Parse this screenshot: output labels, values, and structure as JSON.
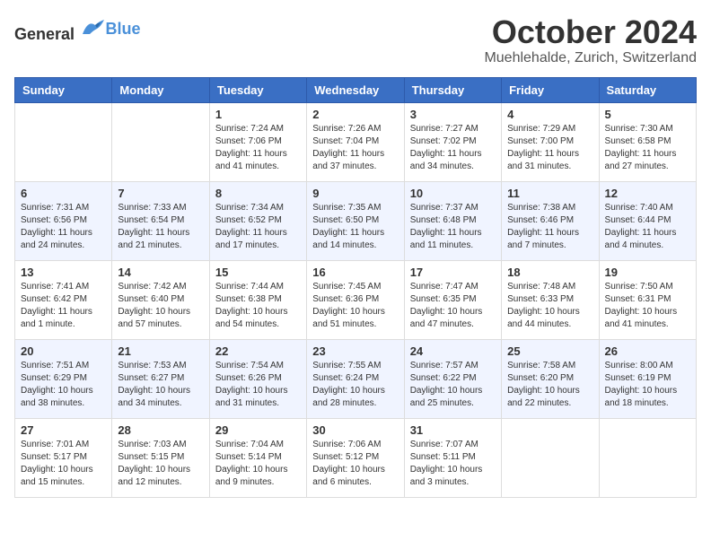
{
  "header": {
    "logo_general": "General",
    "logo_blue": "Blue",
    "month": "October 2024",
    "location": "Muehlehalde, Zurich, Switzerland"
  },
  "weekdays": [
    "Sunday",
    "Monday",
    "Tuesday",
    "Wednesday",
    "Thursday",
    "Friday",
    "Saturday"
  ],
  "weeks": [
    [
      {
        "day": "",
        "content": ""
      },
      {
        "day": "",
        "content": ""
      },
      {
        "day": "1",
        "content": "Sunrise: 7:24 AM\nSunset: 7:06 PM\nDaylight: 11 hours and 41 minutes."
      },
      {
        "day": "2",
        "content": "Sunrise: 7:26 AM\nSunset: 7:04 PM\nDaylight: 11 hours and 37 minutes."
      },
      {
        "day": "3",
        "content": "Sunrise: 7:27 AM\nSunset: 7:02 PM\nDaylight: 11 hours and 34 minutes."
      },
      {
        "day": "4",
        "content": "Sunrise: 7:29 AM\nSunset: 7:00 PM\nDaylight: 11 hours and 31 minutes."
      },
      {
        "day": "5",
        "content": "Sunrise: 7:30 AM\nSunset: 6:58 PM\nDaylight: 11 hours and 27 minutes."
      }
    ],
    [
      {
        "day": "6",
        "content": "Sunrise: 7:31 AM\nSunset: 6:56 PM\nDaylight: 11 hours and 24 minutes."
      },
      {
        "day": "7",
        "content": "Sunrise: 7:33 AM\nSunset: 6:54 PM\nDaylight: 11 hours and 21 minutes."
      },
      {
        "day": "8",
        "content": "Sunrise: 7:34 AM\nSunset: 6:52 PM\nDaylight: 11 hours and 17 minutes."
      },
      {
        "day": "9",
        "content": "Sunrise: 7:35 AM\nSunset: 6:50 PM\nDaylight: 11 hours and 14 minutes."
      },
      {
        "day": "10",
        "content": "Sunrise: 7:37 AM\nSunset: 6:48 PM\nDaylight: 11 hours and 11 minutes."
      },
      {
        "day": "11",
        "content": "Sunrise: 7:38 AM\nSunset: 6:46 PM\nDaylight: 11 hours and 7 minutes."
      },
      {
        "day": "12",
        "content": "Sunrise: 7:40 AM\nSunset: 6:44 PM\nDaylight: 11 hours and 4 minutes."
      }
    ],
    [
      {
        "day": "13",
        "content": "Sunrise: 7:41 AM\nSunset: 6:42 PM\nDaylight: 11 hours and 1 minute."
      },
      {
        "day": "14",
        "content": "Sunrise: 7:42 AM\nSunset: 6:40 PM\nDaylight: 10 hours and 57 minutes."
      },
      {
        "day": "15",
        "content": "Sunrise: 7:44 AM\nSunset: 6:38 PM\nDaylight: 10 hours and 54 minutes."
      },
      {
        "day": "16",
        "content": "Sunrise: 7:45 AM\nSunset: 6:36 PM\nDaylight: 10 hours and 51 minutes."
      },
      {
        "day": "17",
        "content": "Sunrise: 7:47 AM\nSunset: 6:35 PM\nDaylight: 10 hours and 47 minutes."
      },
      {
        "day": "18",
        "content": "Sunrise: 7:48 AM\nSunset: 6:33 PM\nDaylight: 10 hours and 44 minutes."
      },
      {
        "day": "19",
        "content": "Sunrise: 7:50 AM\nSunset: 6:31 PM\nDaylight: 10 hours and 41 minutes."
      }
    ],
    [
      {
        "day": "20",
        "content": "Sunrise: 7:51 AM\nSunset: 6:29 PM\nDaylight: 10 hours and 38 minutes."
      },
      {
        "day": "21",
        "content": "Sunrise: 7:53 AM\nSunset: 6:27 PM\nDaylight: 10 hours and 34 minutes."
      },
      {
        "day": "22",
        "content": "Sunrise: 7:54 AM\nSunset: 6:26 PM\nDaylight: 10 hours and 31 minutes."
      },
      {
        "day": "23",
        "content": "Sunrise: 7:55 AM\nSunset: 6:24 PM\nDaylight: 10 hours and 28 minutes."
      },
      {
        "day": "24",
        "content": "Sunrise: 7:57 AM\nSunset: 6:22 PM\nDaylight: 10 hours and 25 minutes."
      },
      {
        "day": "25",
        "content": "Sunrise: 7:58 AM\nSunset: 6:20 PM\nDaylight: 10 hours and 22 minutes."
      },
      {
        "day": "26",
        "content": "Sunrise: 8:00 AM\nSunset: 6:19 PM\nDaylight: 10 hours and 18 minutes."
      }
    ],
    [
      {
        "day": "27",
        "content": "Sunrise: 7:01 AM\nSunset: 5:17 PM\nDaylight: 10 hours and 15 minutes."
      },
      {
        "day": "28",
        "content": "Sunrise: 7:03 AM\nSunset: 5:15 PM\nDaylight: 10 hours and 12 minutes."
      },
      {
        "day": "29",
        "content": "Sunrise: 7:04 AM\nSunset: 5:14 PM\nDaylight: 10 hours and 9 minutes."
      },
      {
        "day": "30",
        "content": "Sunrise: 7:06 AM\nSunset: 5:12 PM\nDaylight: 10 hours and 6 minutes."
      },
      {
        "day": "31",
        "content": "Sunrise: 7:07 AM\nSunset: 5:11 PM\nDaylight: 10 hours and 3 minutes."
      },
      {
        "day": "",
        "content": ""
      },
      {
        "day": "",
        "content": ""
      }
    ]
  ]
}
